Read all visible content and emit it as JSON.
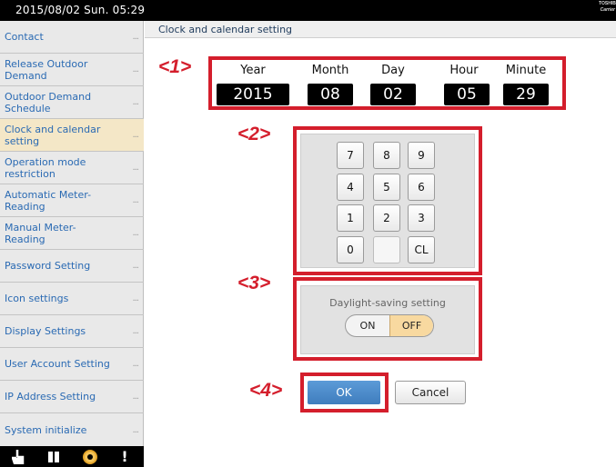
{
  "topbar": {
    "datetime": "2015/08/02 Sun. 05:29",
    "brand_line1": "TOSHIBA",
    "brand_line2": "Carrier"
  },
  "sidebar": {
    "items": [
      {
        "label": "Contact"
      },
      {
        "label": "Release Outdoor\nDemand"
      },
      {
        "label": "Outdoor Demand\nSchedule"
      },
      {
        "label": "Clock and calendar\nsetting",
        "active": true
      },
      {
        "label": "Operation mode\nrestriction"
      },
      {
        "label": "Automatic Meter-\nReading"
      },
      {
        "label": "Manual Meter-\nReading"
      },
      {
        "label": "Password Setting"
      },
      {
        "label": "Icon settings"
      },
      {
        "label": "Display Settings"
      },
      {
        "label": "User Account Setting"
      },
      {
        "label": "IP Address Setting"
      },
      {
        "label": "System initialize"
      }
    ],
    "more": "...",
    "accent_color": "#2a6ab3"
  },
  "bottombar": {
    "icons": [
      "hand-icon",
      "book-icon",
      "gear-icon",
      "alert-icon"
    ]
  },
  "header": {
    "title": "Clock and calendar setting"
  },
  "callouts": {
    "c1": "<1>",
    "c2": "<2>",
    "c3": "<3>",
    "c4": "<4>"
  },
  "datetime_fields": {
    "year": {
      "label": "Year",
      "value": "2015"
    },
    "month": {
      "label": "Month",
      "value": "08"
    },
    "day": {
      "label": "Day",
      "value": "02"
    },
    "hour": {
      "label": "Hour",
      "value": "05"
    },
    "minute": {
      "label": "Minute",
      "value": "29"
    }
  },
  "keypad": {
    "keys": [
      "7",
      "8",
      "9",
      "4",
      "5",
      "6",
      "1",
      "2",
      "3",
      "0",
      "",
      "CL"
    ]
  },
  "daylight": {
    "title": "Daylight-saving setting",
    "on": "ON",
    "off": "OFF",
    "selected": "OFF"
  },
  "actions": {
    "ok": "OK",
    "cancel": "Cancel"
  },
  "colors": {
    "callout": "#d41e2c",
    "ok_button": "#4a88c8",
    "off_selected": "#f8d9a0"
  }
}
